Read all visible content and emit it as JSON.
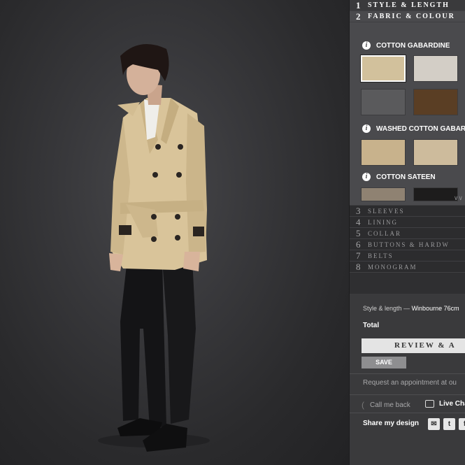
{
  "steps": [
    {
      "num": "1",
      "label": "Style & Length"
    },
    {
      "num": "2",
      "label": "Fabric & Colour"
    },
    {
      "num": "3",
      "label": "Sleeves"
    },
    {
      "num": "4",
      "label": "Lining"
    },
    {
      "num": "5",
      "label": "Collar"
    },
    {
      "num": "6",
      "label": "Buttons & Hardw"
    },
    {
      "num": "7",
      "label": "Belts"
    },
    {
      "num": "8",
      "label": "Monogram"
    }
  ],
  "fabrics": [
    {
      "name": "COTTON GABARDINE",
      "swatches": [
        "#d2c19c",
        "#d3cec6",
        "#5a5a5c",
        "#5a3e24"
      ]
    },
    {
      "name": "WASHED COTTON GABARDI",
      "swatches": [
        "#c8b28c",
        "#cdbb9c"
      ]
    },
    {
      "name": "COTTON SATEEN",
      "swatches": [
        "#8f8272",
        "#1d1c1c"
      ]
    }
  ],
  "info_icon_glyph": "i",
  "scroll_glyph": "∨∨",
  "summary": {
    "style_label": "Style & length —",
    "style_value": "Winbourne 76cm",
    "total_label": "Total",
    "review_label": "REVIEW & A",
    "save_label": "SAVE",
    "appointment": "Request an appointment at ou",
    "callback": "Call me back",
    "livechat": "Live Cha",
    "share": "Share my design"
  },
  "share_icons": {
    "email": "✉",
    "twitter": "t",
    "facebook": "f"
  },
  "colors": {
    "coat": "#d9c49a",
    "panel": "#2f2f31",
    "open_section": "#4a4a4d"
  }
}
